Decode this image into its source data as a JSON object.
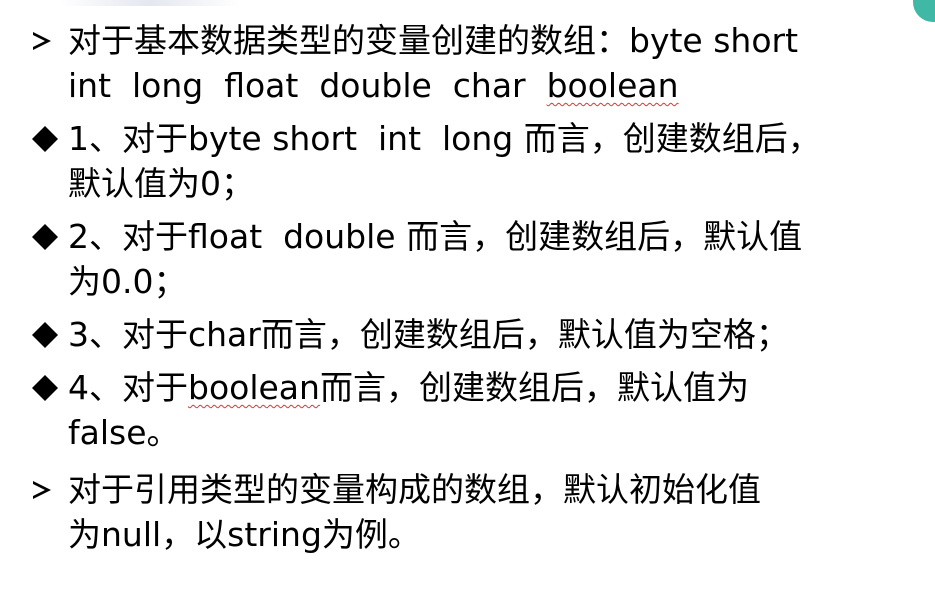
{
  "items": [
    {
      "marker": "arrow-icon",
      "lines": [
        {
          "parts": [
            {
              "text": "对于基本数据类型的变量创建的数组：byte short",
              "squiggle": false
            }
          ]
        },
        {
          "parts": [
            {
              "text": "int  long  float  double  char  ",
              "squiggle": false
            },
            {
              "text": "boolean",
              "squiggle": true
            }
          ]
        }
      ]
    },
    {
      "marker": "diamond-icon",
      "lines": [
        {
          "parts": [
            {
              "text": "1、对于byte short  int  long 而言，创建数组后，",
              "squiggle": false
            }
          ]
        },
        {
          "parts": [
            {
              "text": "默认值为0；",
              "squiggle": false
            }
          ]
        }
      ]
    },
    {
      "marker": "diamond-icon",
      "lines": [
        {
          "parts": [
            {
              "text": "2、对于float  double 而言，创建数组后，默认值",
              "squiggle": false
            }
          ]
        },
        {
          "parts": [
            {
              "text": "为0.0；",
              "squiggle": false
            }
          ]
        }
      ]
    },
    {
      "marker": "diamond-icon",
      "lines": [
        {
          "parts": [
            {
              "text": "3、对于char而言，创建数组后，默认值为空格；",
              "squiggle": false
            }
          ]
        }
      ]
    },
    {
      "marker": "diamond-icon",
      "lines": [
        {
          "parts": [
            {
              "text": "4、对于",
              "squiggle": false
            },
            {
              "text": "boolean",
              "squiggle": true
            },
            {
              "text": "而言，创建数组后，默认值为",
              "squiggle": false
            }
          ]
        },
        {
          "parts": [
            {
              "text": "false。",
              "squiggle": false
            }
          ]
        }
      ]
    },
    {
      "marker": "arrow-icon",
      "lines": [
        {
          "parts": [
            {
              "text": "对于引用类型的变量构成的数组，默认初始化值",
              "squiggle": false
            }
          ]
        },
        {
          "parts": [
            {
              "text": "为null，以string为例。",
              "squiggle": false
            }
          ]
        }
      ]
    }
  ],
  "colors": {
    "text": "#000000",
    "spell_squiggle": "#d23a3a",
    "corner_accent": "#3fb8a6"
  }
}
